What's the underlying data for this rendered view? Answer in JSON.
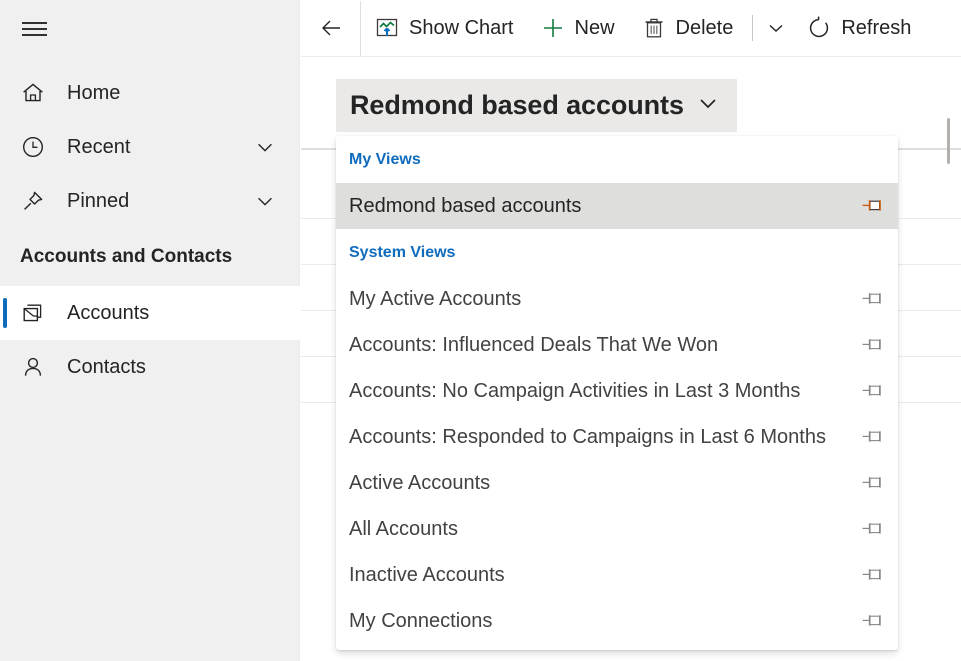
{
  "sidebar": {
    "hamburger": "site-map-toggle",
    "nav": [
      {
        "label": "Home",
        "icon": "home-icon",
        "chevron": false
      },
      {
        "label": "Recent",
        "icon": "clock-icon",
        "chevron": true
      },
      {
        "label": "Pinned",
        "icon": "pin-icon",
        "chevron": true
      }
    ],
    "group_title": "Accounts and Contacts",
    "group_items": [
      {
        "label": "Accounts",
        "icon": "accounts-icon",
        "selected": true
      },
      {
        "label": "Contacts",
        "icon": "contact-icon",
        "selected": false
      }
    ],
    "selection_color": "#0f6cbd"
  },
  "toolbar": {
    "back": "back-arrow-icon",
    "buttons": [
      {
        "label": "Show Chart",
        "icon": "show-chart-icon"
      },
      {
        "label": "New",
        "icon": "plus-icon"
      },
      {
        "label": "Delete",
        "icon": "trash-icon"
      }
    ],
    "overflow_caret": "chevron-down-icon",
    "refresh_label": "Refresh",
    "refresh_icon": "refresh-icon"
  },
  "view_selector": {
    "current_view": "Redmond based accounts",
    "chevron": "chevron-down-icon",
    "background": "#ebe9e7"
  },
  "flyout": {
    "sections": [
      {
        "title": "My Views",
        "items": [
          {
            "label": "Redmond based accounts",
            "pin": "pin-icon",
            "active": true
          }
        ]
      },
      {
        "title": "System Views",
        "items": [
          {
            "label": "My Active Accounts",
            "pin": "pin-icon",
            "active": false
          },
          {
            "label": "Accounts: Influenced Deals That We Won",
            "pin": "pin-icon",
            "active": false
          },
          {
            "label": "Accounts: No Campaign Activities in Last 3 Months",
            "pin": "pin-icon",
            "active": false
          },
          {
            "label": "Accounts: Responded to Campaigns in Last 6 Months",
            "pin": "pin-icon",
            "active": false
          },
          {
            "label": "Active Accounts",
            "pin": "pin-icon",
            "active": false
          },
          {
            "label": "All Accounts",
            "pin": "pin-icon",
            "active": false
          },
          {
            "label": "Inactive Accounts",
            "pin": "pin-icon",
            "active": false
          },
          {
            "label": "My Connections",
            "pin": "pin-icon",
            "active": false
          }
        ]
      }
    ],
    "section_color": "#0f6cbd"
  }
}
